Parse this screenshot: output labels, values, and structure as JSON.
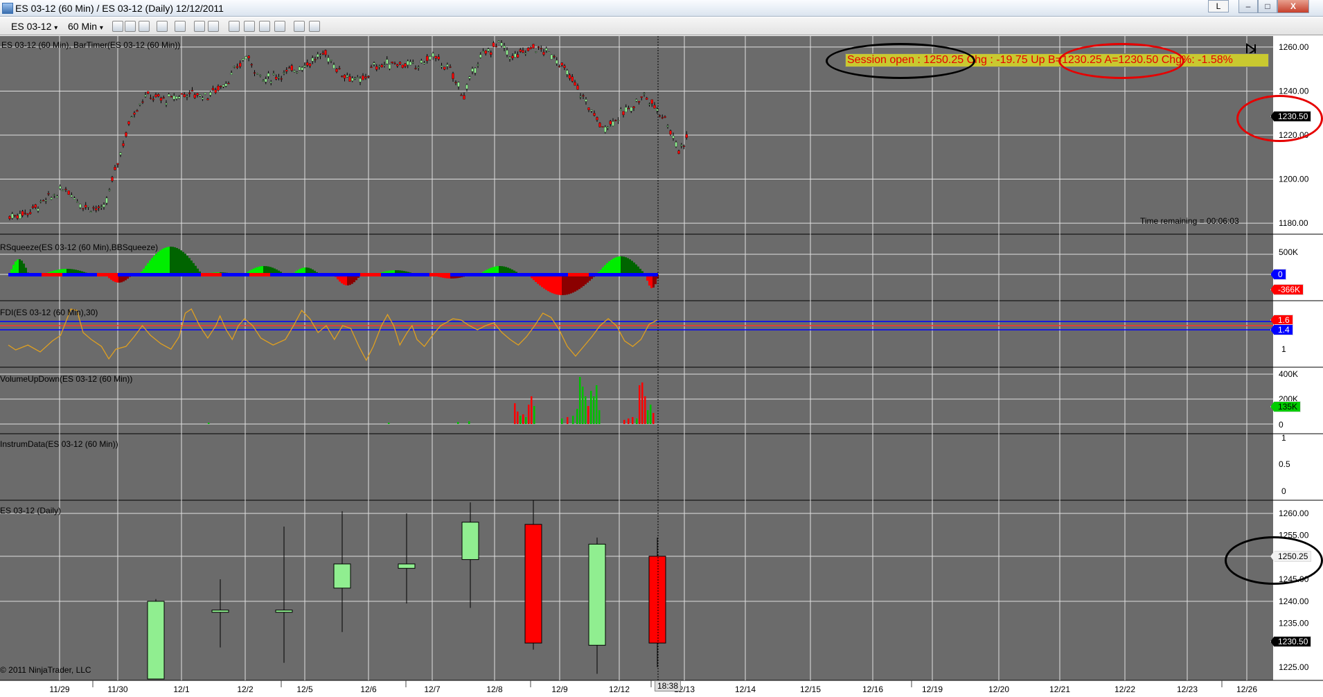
{
  "window": {
    "title": "ES 03-12 (60 Min) / ES 03-12 (Daily)  12/12/2011",
    "l_button": "L",
    "minimize": "–",
    "maximize": "□",
    "close": "X"
  },
  "toolbar": {
    "instrument": "ES 03-12",
    "interval": "60 Min"
  },
  "panels": {
    "price": {
      "label": "ES 03-12 (60 Min),  BarTimer(ES 03-12 (60 Min))",
      "axis": [
        "1260.00",
        "1240.00",
        "1230.50",
        "1220.00",
        "1200.00",
        "1180.00"
      ],
      "current": "1230.50",
      "time_remaining": "Time remaining = 00:06:03",
      "info": "Session open : 1250.25  Chg  : -19.75 Up B=1230.25  A=1230.50  Chg%: -1.58%",
      "annotations": {
        "session_circle_color": "#000000",
        "bidask_circle_color": "#e60000",
        "price_circle_color": "#e60000"
      }
    },
    "rsqueeze": {
      "label": "RSqueeze(ES 03-12 (60 Min),BBSqueeze)",
      "axis": [
        "500K",
        "0",
        "-366K"
      ],
      "zero_badge": "0",
      "value_badge": "-366K"
    },
    "fdi": {
      "label": "FDI(ES 03-12 (60 Min),30)",
      "axis": [
        "1.6",
        "1.4",
        "1"
      ],
      "badge_1": "1.6",
      "badge_2": "1.4"
    },
    "volume": {
      "label": "VolumeUpDown(ES 03-12 (60 Min))",
      "axis": [
        "400K",
        "200K",
        "0"
      ],
      "badge": "135K"
    },
    "instrumdata": {
      "label": "InstrumData(ES 03-12 (60 Min))",
      "axis": [
        "1",
        "0.5",
        "0"
      ]
    },
    "daily": {
      "label": "ES 03-12 (Daily)",
      "axis": [
        "1260.00",
        "1255.00",
        "1250.25",
        "1245.00",
        "1240.00",
        "1235.00",
        "1230.50",
        "1225.00"
      ],
      "open_badge": "1250.25",
      "current_badge": "1230.50",
      "copyright": "© 2011 NinjaTrader, LLC"
    }
  },
  "xaxis": {
    "labels": [
      "11/29",
      "11/30",
      "12/1",
      "12/2",
      "12/5",
      "12/6",
      "12/7",
      "12/8",
      "12/9",
      "12/12",
      "12/13",
      "12/14",
      "12/15",
      "12/16",
      "12/19",
      "12/20",
      "12/21",
      "12/22",
      "12/23",
      "12/26"
    ],
    "current_time": "18:38"
  },
  "colors": {
    "background": "#6b6b6b",
    "up_candle": "#90ee90",
    "down_candle": "#ff0000",
    "grid": "#e0e0e0",
    "squeeze_up": "#00ee00",
    "squeeze_dark": "#006400",
    "squeeze_down": "#ff0000",
    "squeeze_line": "#0000ff",
    "fdi_line": "#e0a020",
    "vol_up": "#00c000",
    "vol_down": "#ff0000"
  },
  "daily_candles": [
    {
      "o": 1217.0,
      "h": 1240.5,
      "l": 1217.0,
      "c": 1240.0
    },
    {
      "o": 1237.5,
      "h": 1245.0,
      "l": 1229.5,
      "c": 1238.0
    },
    {
      "o": 1237.5,
      "h": 1257.0,
      "l": 1226.0,
      "c": 1238.0
    },
    {
      "o": 1243.0,
      "h": 1260.5,
      "l": 1233.0,
      "c": 1248.5
    },
    {
      "o": 1247.5,
      "h": 1260.0,
      "l": 1239.5,
      "c": 1248.5
    },
    {
      "o": 1249.5,
      "h": 1262.5,
      "l": 1238.5,
      "c": 1258.0
    },
    {
      "o": 1257.5,
      "h": 1263.0,
      "l": 1229.0,
      "c": 1230.5
    },
    {
      "o": 1230.0,
      "h": 1254.5,
      "l": 1223.5,
      "c": 1253.0
    },
    {
      "o": 1250.25,
      "h": 1254.5,
      "l": 1225.0,
      "c": 1230.5
    }
  ]
}
